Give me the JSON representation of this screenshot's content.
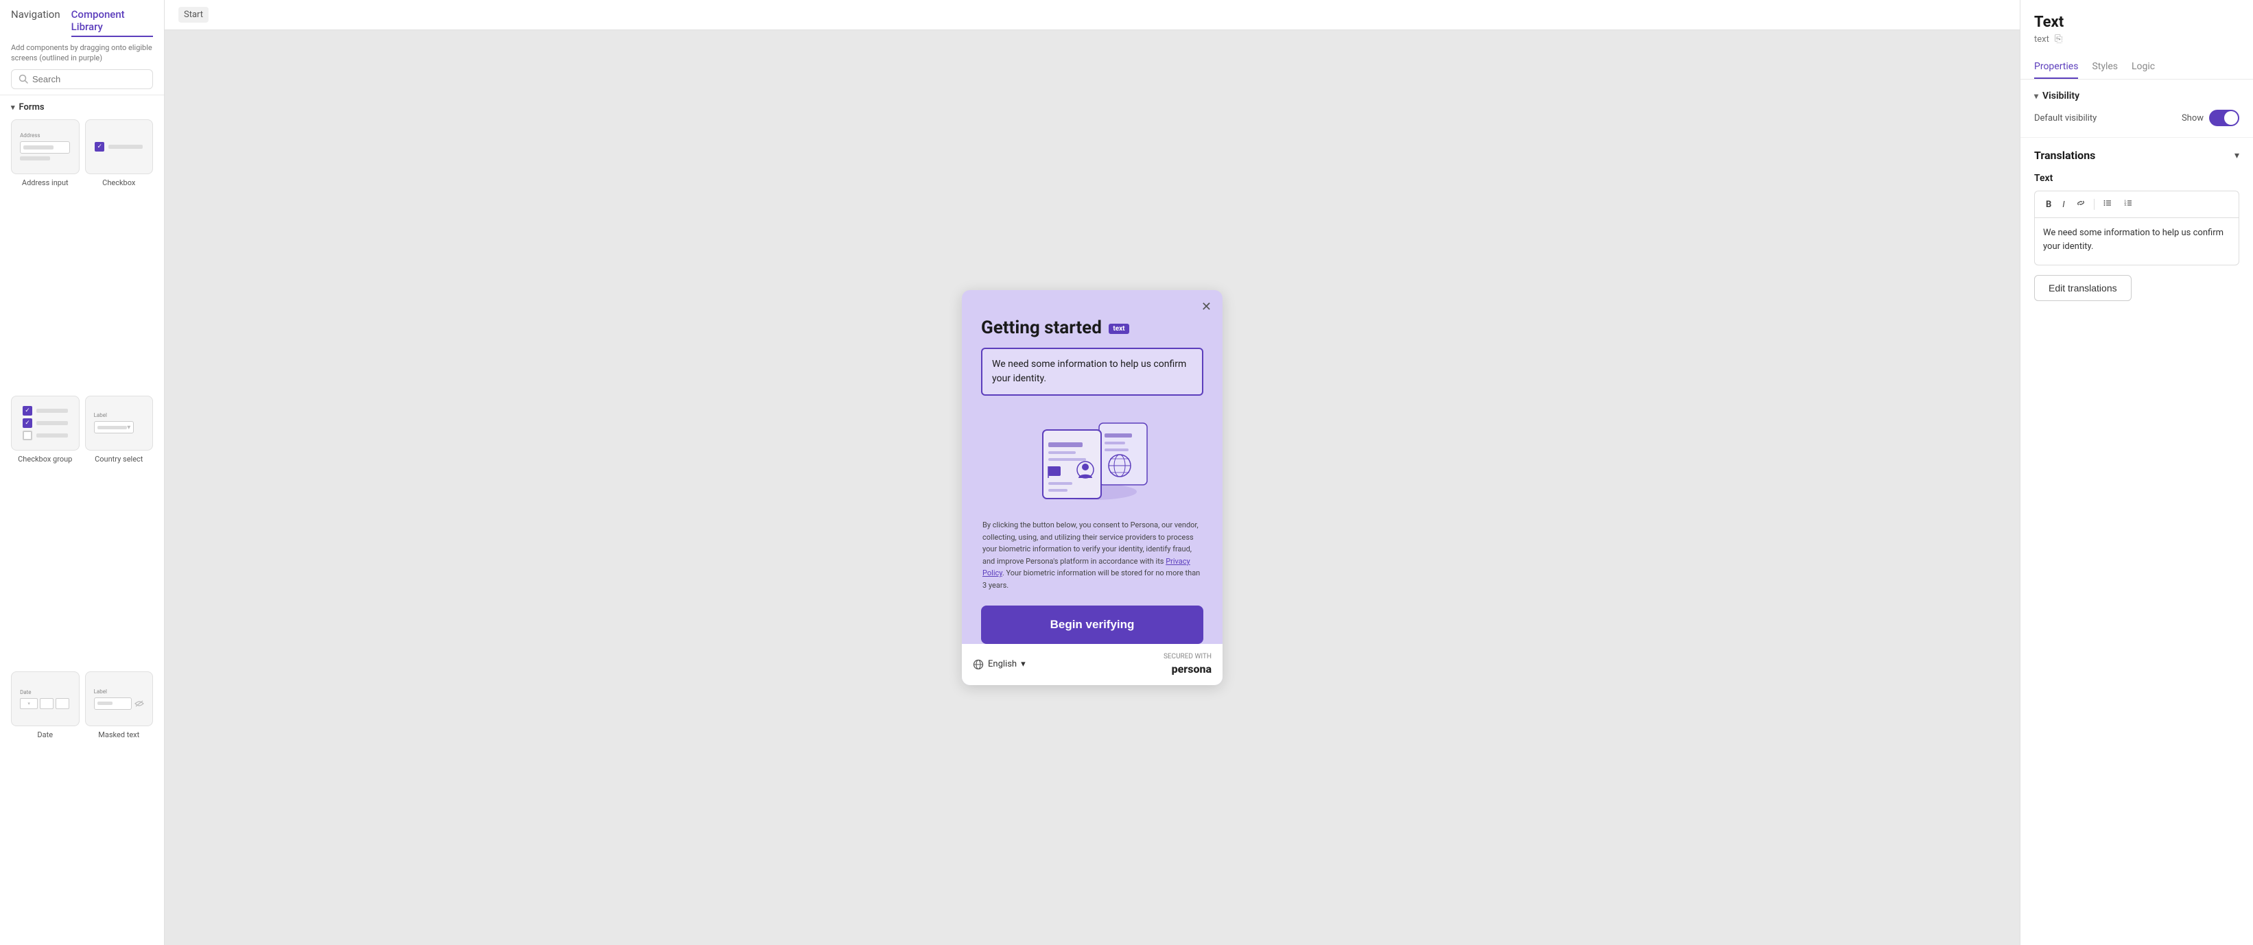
{
  "sidebar": {
    "nav_tab_navigation": "Navigation",
    "nav_tab_library": "Component Library",
    "hint": "Add components by dragging onto eligible screens (outlined in purple)",
    "search_placeholder": "Search",
    "section_forms": "Forms",
    "components": [
      {
        "id": "address-input",
        "label": "Address input",
        "type": "address"
      },
      {
        "id": "checkbox",
        "label": "Checkbox",
        "type": "checkbox"
      },
      {
        "id": "checkbox-group",
        "label": "Checkbox group",
        "type": "checkbox-group"
      },
      {
        "id": "country-select",
        "label": "Country select",
        "type": "country-select"
      },
      {
        "id": "date",
        "label": "Date",
        "type": "date"
      },
      {
        "id": "masked-text",
        "label": "Masked text",
        "type": "masked-text"
      }
    ]
  },
  "canvas": {
    "tab_label": "Start",
    "modal": {
      "title": "Getting started",
      "text_badge": "text",
      "description": "We need some information to help us confirm your identity.",
      "consent_text": "By clicking the button below, you consent to Persona, our vendor, collecting, using, and utilizing their service providers to process your biometric information to verify your identity, identify fraud, and improve Persona's platform in accordance with its ",
      "privacy_policy_link": "Privacy Policy",
      "consent_text_end": ". Your biometric information will be stored for no more than 3 years.",
      "cta_button": "Begin verifying",
      "footer_language": "English",
      "footer_secured": "SECURED WITH",
      "footer_brand": "persona"
    }
  },
  "right_panel": {
    "title": "Text",
    "subtitle": "text",
    "copy_icon": "⎘",
    "tabs": [
      {
        "id": "properties",
        "label": "Properties",
        "active": true
      },
      {
        "id": "styles",
        "label": "Styles",
        "active": false
      },
      {
        "id": "logic",
        "label": "Logic",
        "active": false
      }
    ],
    "visibility_section": {
      "title": "Visibility",
      "default_visibility_label": "Default visibility",
      "show_label": "Show"
    },
    "translations_section": {
      "title": "Translations",
      "text_field_label": "Text",
      "rich_text_content": "We need some information to help us confirm your identity.",
      "edit_button": "Edit translations",
      "toolbar": {
        "bold": "B",
        "italic": "I",
        "link": "🔗",
        "list_unordered": "≡",
        "list_ordered": "≣"
      }
    }
  }
}
